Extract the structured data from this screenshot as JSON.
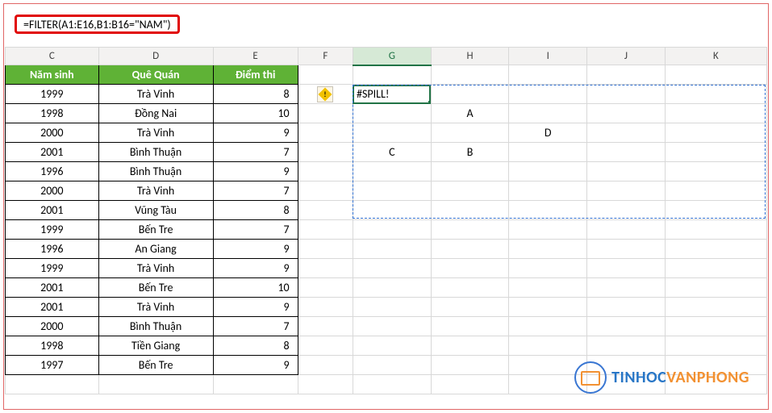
{
  "formula_bar": {
    "value": "=FILTER(A1:E16,B1:B16=\"NAM\")"
  },
  "columns": [
    "C",
    "D",
    "E",
    "F",
    "G",
    "H",
    "I",
    "J",
    "K"
  ],
  "active_column_index": 4,
  "headers": {
    "C": "Năm sinh",
    "D": "Quê Quán",
    "E": "Điểm thi"
  },
  "rows": [
    {
      "C": "1999",
      "D": "Trà Vinh",
      "E": "8"
    },
    {
      "C": "1998",
      "D": "Đồng Nai",
      "E": "10"
    },
    {
      "C": "2000",
      "D": "Trà Vinh",
      "E": "9"
    },
    {
      "C": "2001",
      "D": "Bình Thuận",
      "E": "7"
    },
    {
      "C": "1996",
      "D": "Bình Thuận",
      "E": "9"
    },
    {
      "C": "2000",
      "D": "Trà Vinh",
      "E": "7"
    },
    {
      "C": "2001",
      "D": "Vũng Tàu",
      "E": "8"
    },
    {
      "C": "1999",
      "D": "Bến Tre",
      "E": "7"
    },
    {
      "C": "1996",
      "D": "An Giang",
      "E": "9"
    },
    {
      "C": "1999",
      "D": "Trà Vinh",
      "E": "9"
    },
    {
      "C": "2001",
      "D": "Bến Tre",
      "E": "10"
    },
    {
      "C": "2001",
      "D": "Trà Vinh",
      "E": "9"
    },
    {
      "C": "2000",
      "D": "Bình Thuận",
      "E": "7"
    },
    {
      "C": "1998",
      "D": "Tiền Giang",
      "E": "8"
    },
    {
      "C": "1997",
      "D": "Bến Tre",
      "E": "9"
    }
  ],
  "selected_cell": {
    "value": "#SPILL!"
  },
  "obstructing": {
    "H3": "A",
    "I4": "D",
    "G5": "C",
    "H5": "B"
  },
  "error_tag": {
    "glyph": "!"
  },
  "watermark": {
    "blue": "TINHOC",
    "orange": "VANPHONG"
  },
  "chart_data": {
    "type": "table",
    "title": "",
    "columns": [
      "Năm sinh",
      "Quê Quán",
      "Điểm thi"
    ],
    "rows": [
      [
        1999,
        "Trà Vinh",
        8
      ],
      [
        1998,
        "Đồng Nai",
        10
      ],
      [
        2000,
        "Trà Vinh",
        9
      ],
      [
        2001,
        "Bình Thuận",
        7
      ],
      [
        1996,
        "Bình Thuận",
        9
      ],
      [
        2000,
        "Trà Vinh",
        7
      ],
      [
        2001,
        "Vũng Tàu",
        8
      ],
      [
        1999,
        "Bến Tre",
        7
      ],
      [
        1996,
        "An Giang",
        9
      ],
      [
        1999,
        "Trà Vinh",
        9
      ],
      [
        2001,
        "Bến Tre",
        10
      ],
      [
        2001,
        "Trà Vinh",
        9
      ],
      [
        2000,
        "Bình Thuận",
        7
      ],
      [
        1998,
        "Tiền Giang",
        8
      ],
      [
        1997,
        "Bến Tre",
        9
      ]
    ]
  }
}
